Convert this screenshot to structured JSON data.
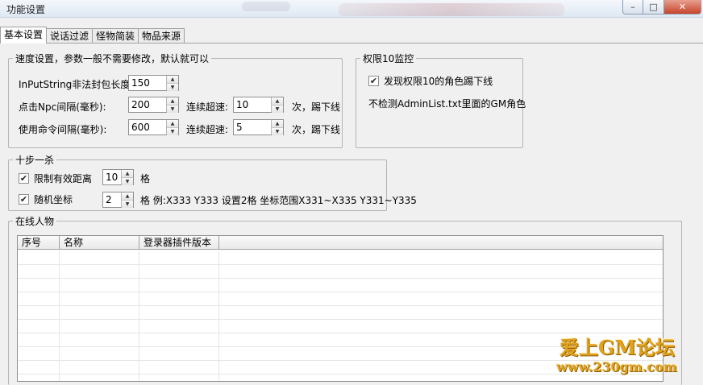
{
  "window": {
    "title": "功能设置",
    "buttons": {
      "minimize": "–",
      "maximize": "□",
      "close": "✕"
    }
  },
  "tabs": [
    {
      "label": "基本设置",
      "active": true
    },
    {
      "label": "说话过滤",
      "active": false
    },
    {
      "label": "怪物简装",
      "active": false
    },
    {
      "label": "物品来源",
      "active": false
    }
  ],
  "speed": {
    "legend": "速度设置，参数一般不需要修改，默认就可以",
    "inputstring_label": "InPutString非法封包长度:",
    "inputstring_value": "150",
    "npc_label": "点击Npc间隔(毫秒):",
    "npc_value": "200",
    "npc_overspeed_label": "连续超速:",
    "npc_overspeed_value": "10",
    "npc_suffix": "次，踢下线",
    "cmd_label": "使用命令间隔(毫秒):",
    "cmd_value": "600",
    "cmd_overspeed_label": "连续超速:",
    "cmd_overspeed_value": "5",
    "cmd_suffix": "次，踢下线"
  },
  "perm": {
    "legend": "权限10监控",
    "kick_label": "发现权限10的角色踢下线",
    "kick_checked": true,
    "note": "不检测AdminList.txt里面的GM角色"
  },
  "tenstep": {
    "legend": "十步一杀",
    "limit_label": "限制有效距离",
    "limit_checked": true,
    "limit_value": "10",
    "limit_unit": "格",
    "random_label": "随机坐标",
    "random_checked": true,
    "random_value": "2",
    "random_desc": "格 例:X333 Y333 设置2格 坐标范围X331~X335 Y331~Y335"
  },
  "online": {
    "legend": "在线人物",
    "columns": [
      "序号",
      "名称",
      "登录器插件版本"
    ]
  },
  "watermark": {
    "line1": "爱上GM论坛",
    "line2": "www.230gm.com"
  }
}
